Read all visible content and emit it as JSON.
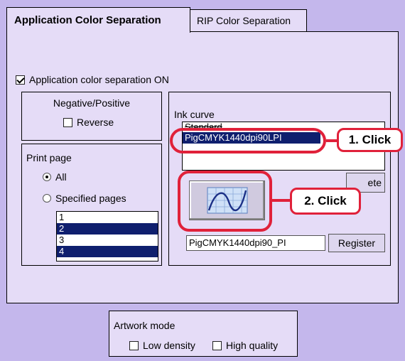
{
  "tabs": [
    {
      "label": "Application Color Separation"
    },
    {
      "label": "RIP Color Separation"
    }
  ],
  "sep_on": {
    "label": "Application color separation ON",
    "checked": true
  },
  "negpos": {
    "title": "Negative/Positive",
    "reverse_label": "Reverse"
  },
  "print_page": {
    "title": "Print page",
    "all_label": "All",
    "specified_label": "Specified pages",
    "pages": [
      "1",
      "2",
      "3",
      "4"
    ]
  },
  "ink_curve": {
    "title": "Ink curve",
    "items": [
      "Standard",
      "PigCMYK1440dpi90LPI"
    ],
    "delete_label": "ete",
    "name_value": "PigCMYK1440dpi90_PI",
    "register_label": "Register"
  },
  "artwork": {
    "title": "Artwork mode",
    "low_label": "Low density",
    "high_label": "High quality"
  },
  "callouts": {
    "one": "1. Click",
    "two": "2. Click"
  },
  "colors": {
    "accent_red": "#e0213a",
    "selection": "#0f1f6e",
    "background": "#c4b7ec",
    "panel": "#e5dcf7"
  },
  "icons": [
    "curve-graph-icon"
  ]
}
